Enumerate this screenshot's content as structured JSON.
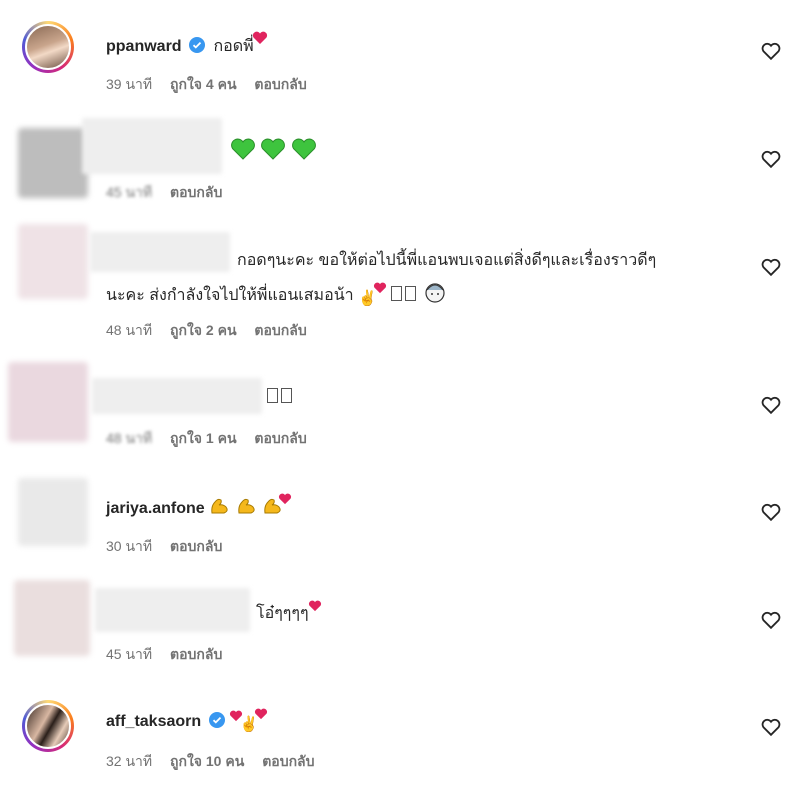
{
  "comments": [
    {
      "username": "ppanward",
      "text": "กอดพี่",
      "time": "39 นาที",
      "likes": "ถูกใจ 4 คน",
      "reply": "ตอบกลับ"
    },
    {
      "username": "",
      "text": "",
      "time": "45 นาที",
      "likes": "",
      "reply": "ตอบกลับ"
    },
    {
      "username": "",
      "text_line1": "กอดๆนะคะ ขอให้ต่อไปนี้พี่แอนพบเจอแต่สิ่งดีๆและเรื่องราวดีๆ",
      "text_line2": "นะคะ ส่งกำลังใจไปให้พี่แอนเสมอน้า",
      "time": "48 นาที",
      "likes": "ถูกใจ 2 คน",
      "reply": "ตอบกลับ"
    },
    {
      "username": "",
      "text": "",
      "time": "48 นาที",
      "likes": "ถูกใจ 1 คน",
      "reply": "ตอบกลับ"
    },
    {
      "username": "jariya.anfone",
      "text": "",
      "time": "30 นาที",
      "likes": "",
      "reply": "ตอบกลับ"
    },
    {
      "username": "",
      "text": "โอ๋ๆๆๆๆ",
      "time": "45 นาที",
      "likes": "",
      "reply": "ตอบกลับ"
    },
    {
      "username": "aff_taksaorn",
      "text": "",
      "time": "32 นาที",
      "likes": "ถูกใจ 10 คน",
      "reply": "ตอบกลับ"
    }
  ],
  "icons": {
    "like": "heart-outline-icon",
    "verified": "verified-badge-icon"
  },
  "colors": {
    "verified": "#3897f0",
    "heart": "#e0245e",
    "green_heart": "#3ec43e",
    "flex": "#f5b81c"
  }
}
